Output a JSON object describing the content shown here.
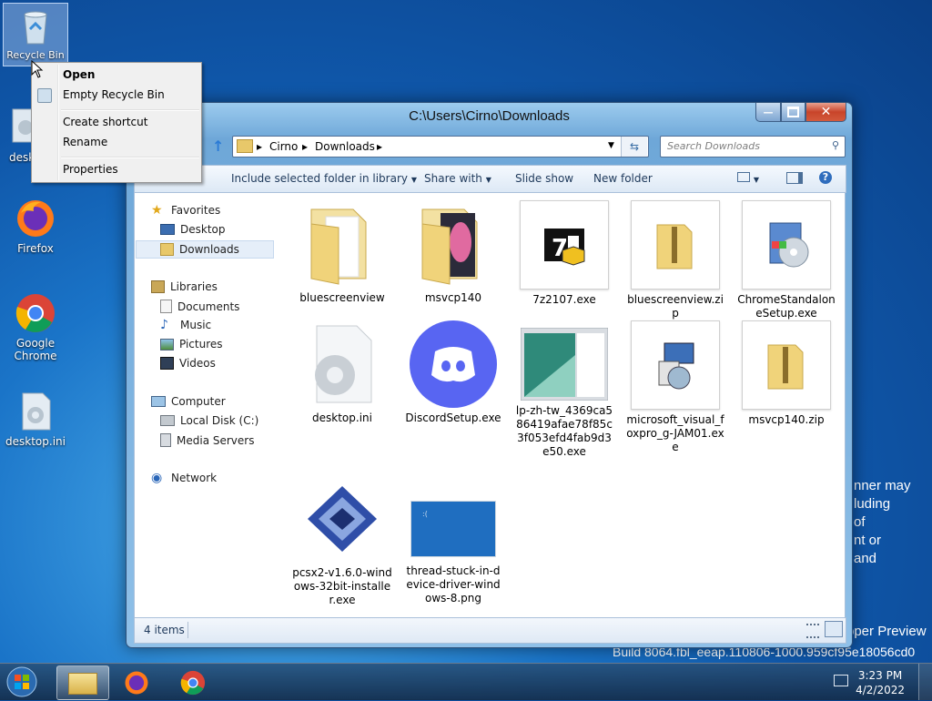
{
  "desktop": {
    "icons": [
      {
        "label": "Recycle Bin"
      },
      {
        "label": "desk"
      },
      {
        "label": "Firefox"
      },
      {
        "label": "Google Chrome"
      },
      {
        "label": "desktop.ini"
      }
    ],
    "watermark_lines": [
      "nner may",
      "luding",
      "of",
      "nt or",
      "and"
    ],
    "build_line1": "pper Preview",
    "build_line2": "Build 8064.fbl_eeap.110806-1000.959cf95e18056cd0"
  },
  "context_menu": {
    "items": [
      "Open",
      "Empty Recycle Bin",
      "Create shortcut",
      "Rename",
      "Properties"
    ]
  },
  "explorer": {
    "title": "C:\\Users\\Cirno\\Downloads",
    "address": {
      "segments": [
        "Cirno",
        "Downloads"
      ]
    },
    "search_placeholder": "Search Downloads",
    "toolbar": {
      "include": "Include selected folder in library",
      "share": "Share with",
      "slideshow": "Slide show",
      "newfolder": "New folder"
    },
    "nav": {
      "favorites": "Favorites",
      "desktop": "Desktop",
      "downloads": "Downloads",
      "libraries": "Libraries",
      "documents": "Documents",
      "music": "Music",
      "pictures": "Pictures",
      "videos": "Videos",
      "computer": "Computer",
      "localdisk": "Local Disk (C:)",
      "mediaservers": "Media Servers",
      "network": "Network"
    },
    "files": [
      {
        "name": "bluescreenview",
        "icon": "folder-icon"
      },
      {
        "name": "msvcp140",
        "icon": "folder-icon"
      },
      {
        "name": "7z2107.exe",
        "icon": "7zip-icon"
      },
      {
        "name": "bluescreenview.zip",
        "icon": "zip-folder-icon"
      },
      {
        "name": "ChromeStandaloneSetup.exe",
        "icon": "installer-icon"
      },
      {
        "name": "desktop.ini",
        "icon": "settings-file-icon"
      },
      {
        "name": "DiscordSetup.exe",
        "icon": "discord-icon"
      },
      {
        "name": "lp-zh-tw_4369ca586419afae78f85c3f053efd4fab9d3e50.exe",
        "icon": "exe-icon"
      },
      {
        "name": "microsoft_visual_foxpro_g-JAM01.exe",
        "icon": "installer-icon"
      },
      {
        "name": "msvcp140.zip",
        "icon": "zip-folder-icon"
      },
      {
        "name": "pcsx2-v1.6.0-windows-32bit-installer.exe",
        "icon": "pcsx2-icon"
      },
      {
        "name": "thread-stuck-in-device-driver-windows-8.png",
        "icon": "image-icon"
      }
    ],
    "status": "4 items"
  },
  "taskbar": {
    "time": "3:23 PM",
    "date": "4/2/2022"
  }
}
